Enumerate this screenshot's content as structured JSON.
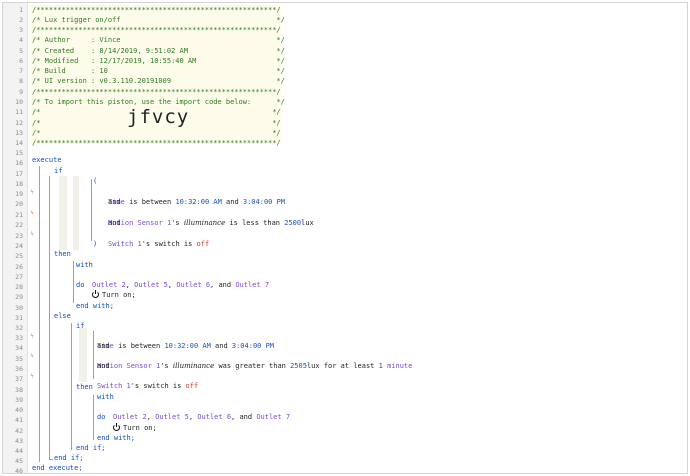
{
  "lines": [
    {
      "n": "1",
      "t": "/*********************************************************/"
    },
    {
      "n": "2",
      "t": "/* Lux trigger on/off                                     */"
    },
    {
      "n": "3",
      "t": "/*********************************************************/"
    },
    {
      "n": "4",
      "t": "/* Author     : Vince                                     */"
    },
    {
      "n": "5",
      "t": "/* Created    : 8/14/2019, 9:51:02 AM                     */"
    },
    {
      "n": "6",
      "t": "/* Modified   : 12/17/2019, 10:55:40 AM                   */"
    },
    {
      "n": "7",
      "t": "/* Build      : 10                                        */"
    },
    {
      "n": "8",
      "t": "/* UI version : v0.3.110.20191009                         */"
    },
    {
      "n": "9",
      "t": "/*********************************************************/"
    },
    {
      "n": "10",
      "t": "/* To import this piston, use the import code below:      */"
    },
    {
      "n": "11",
      "t": "/*                                                       */"
    },
    {
      "n": "12",
      "t": "/*                                                       */"
    },
    {
      "n": "13",
      "t": "/*                                                       */"
    },
    {
      "n": "14",
      "t": "/*********************************************************/"
    },
    {
      "n": "15",
      "t": ""
    },
    {
      "n": "16",
      "t": ""
    },
    {
      "n": "17",
      "t": ""
    },
    {
      "n": "18",
      "t": ""
    },
    {
      "n": "19",
      "t": ""
    },
    {
      "n": "20",
      "t": ""
    },
    {
      "n": "21",
      "t": ""
    },
    {
      "n": "22",
      "t": ""
    },
    {
      "n": "23",
      "t": ""
    },
    {
      "n": "24",
      "t": ""
    },
    {
      "n": "25",
      "t": ""
    },
    {
      "n": "26",
      "t": ""
    },
    {
      "n": "27",
      "t": ""
    },
    {
      "n": "28",
      "t": ""
    },
    {
      "n": "29",
      "t": ""
    },
    {
      "n": "30",
      "t": ""
    },
    {
      "n": "31",
      "t": ""
    },
    {
      "n": "32",
      "t": ""
    },
    {
      "n": "33",
      "t": ""
    },
    {
      "n": "34",
      "t": ""
    },
    {
      "n": "35",
      "t": ""
    },
    {
      "n": "36",
      "t": ""
    },
    {
      "n": "37",
      "t": ""
    },
    {
      "n": "38",
      "t": ""
    },
    {
      "n": "39",
      "t": ""
    },
    {
      "n": "40",
      "t": ""
    },
    {
      "n": "41",
      "t": ""
    },
    {
      "n": "42",
      "t": ""
    },
    {
      "n": "43",
      "t": ""
    },
    {
      "n": "44",
      "t": ""
    },
    {
      "n": "45",
      "t": ""
    },
    {
      "n": "46",
      "t": ""
    }
  ],
  "import_code": "jfvcy",
  "code": {
    "execute": "execute",
    "if": "if",
    "paren_open": "(",
    "paren_close": ")",
    "then": "then",
    "else": "else",
    "with": "with",
    "do": "do",
    "and": "and",
    "end_with": "end with;",
    "end_if": "end if;",
    "end_execute": "end execute;",
    "turn_on": "Turn on;",
    "time_word": "Time",
    "is_between": " is between ",
    "time_a": "10:32:00 AM",
    "and_word": " and ",
    "time_b": "3:04:00 PM",
    "motion_sensor": "Motion Sensor 1",
    "s_poss": "'s ",
    "illuminance": "illuminance",
    "is_less_than": " is less than ",
    "lux_2500": "2500",
    "lux_unit": "lux",
    "switch": "Switch 1",
    "switch_word": "switch",
    "is_word": " is ",
    "off": "off",
    "outlets": [
      "Outlet 2",
      "Outlet 5",
      "Outlet 6",
      "Outlet 7"
    ],
    "comma": ", ",
    "and_outlet": ", and ",
    "was_greater_than": " was greater than ",
    "lux_2505": "2505",
    "for_at_least": " for at least ",
    "one": "1",
    "minute": "minute"
  }
}
